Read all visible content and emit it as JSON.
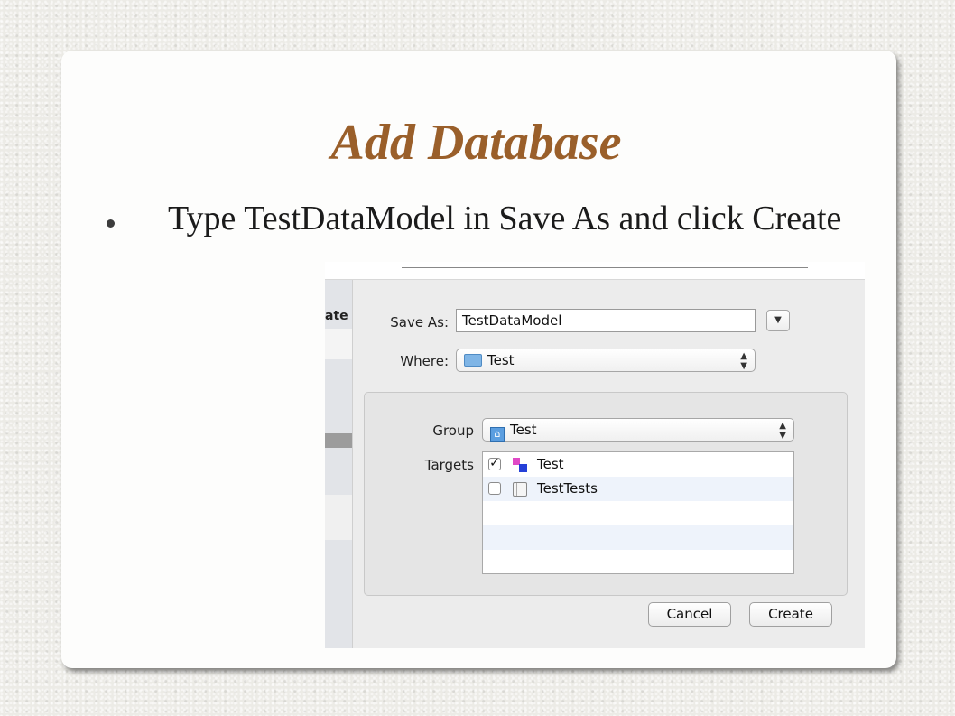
{
  "slide": {
    "title": "Add Database",
    "bullet": "Type TestDataModel in Save As and click Create"
  },
  "dialog": {
    "partial_left_text": "ate",
    "save_as_label": "Save As:",
    "save_as_value": "TestDataModel",
    "where_label": "Where:",
    "where_value": "Test",
    "group_label": "Group",
    "group_value": "Test",
    "targets_label": "Targets",
    "targets": [
      {
        "name": "Test",
        "checked": true,
        "icon": "app-target-icon"
      },
      {
        "name": "TestTests",
        "checked": false,
        "icon": "test-bundle-icon"
      }
    ],
    "cancel_label": "Cancel",
    "create_label": "Create"
  },
  "colors": {
    "title": "#9a5f2a",
    "background": "#ecebe6"
  }
}
